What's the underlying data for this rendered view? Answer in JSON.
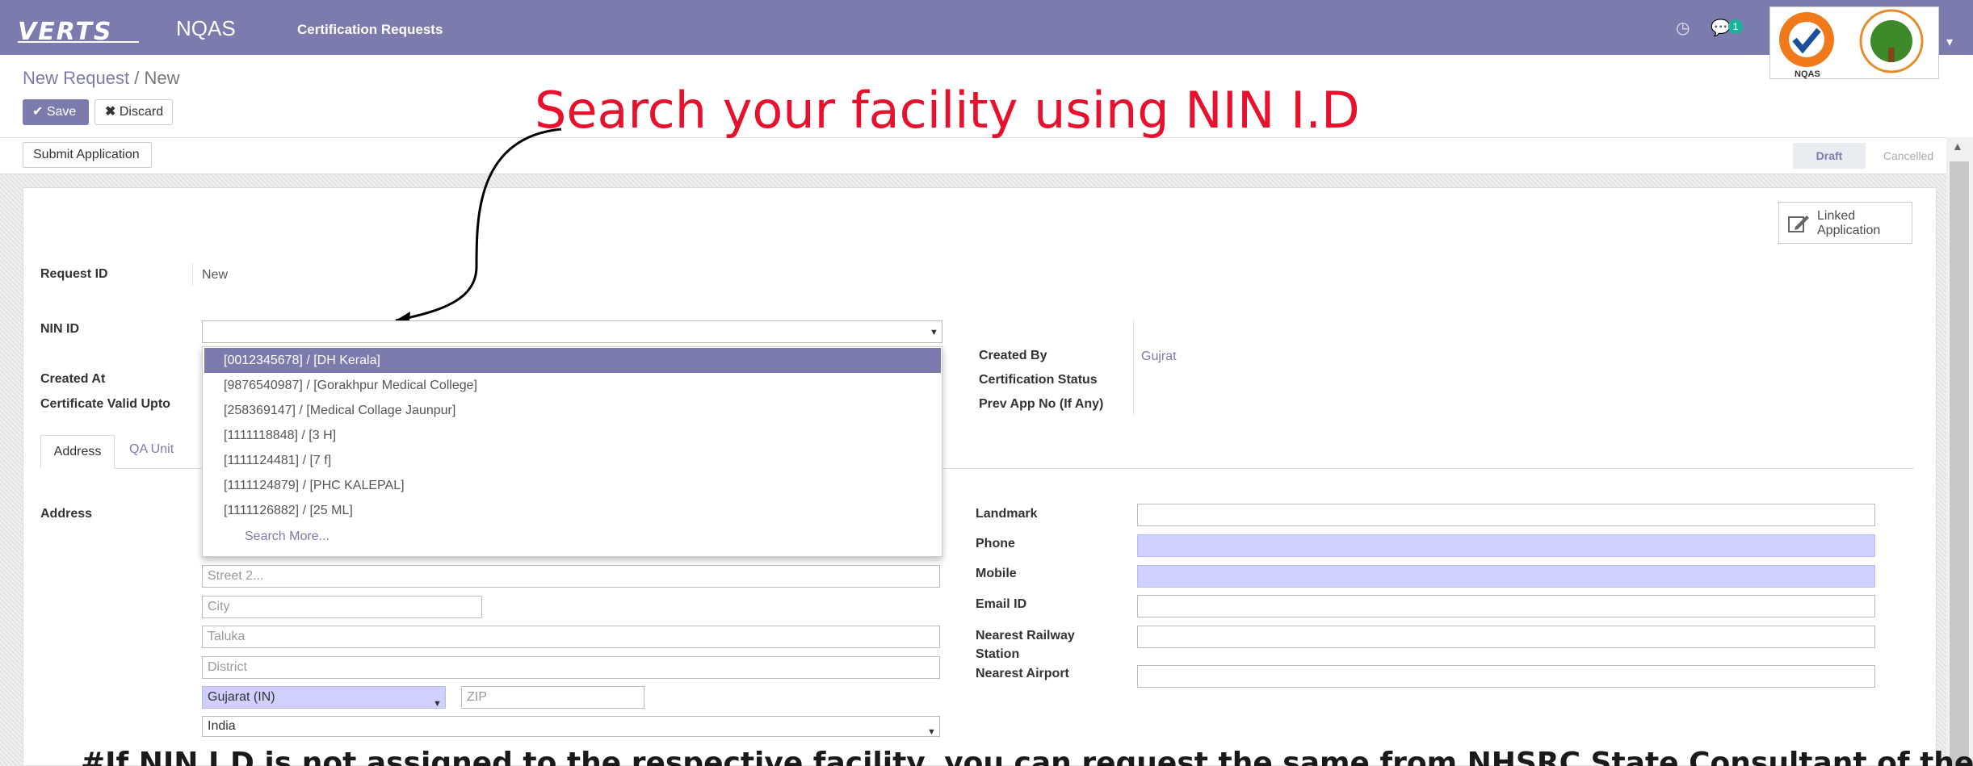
{
  "navbar": {
    "logo_text": "VERTS",
    "app_name": "NQAS",
    "menu_item": "Certification Requests",
    "messages_count": "1",
    "logo_badge": "NQAS"
  },
  "breadcrumb": {
    "parent": "New Request",
    "separator": "/",
    "current": "New"
  },
  "buttons": {
    "save": "Save",
    "discard": "Discard",
    "submit": "Submit Application"
  },
  "statusbar": {
    "stages": [
      "Draft",
      "Cancelled"
    ],
    "active": "Draft"
  },
  "annotation": {
    "title": "Search your facility using NIN I.D",
    "footer": "#If NIN I.D is not assigned to the respective facility, you can request the same from NHSRC State Consultant of the"
  },
  "smart_button": {
    "label": "Linked Application"
  },
  "form": {
    "request_id_label": "Request ID",
    "request_id_value": "New",
    "nin_id_label": "NIN ID",
    "nin_id_value": "",
    "created_at_label": "Created At",
    "valid_upto_label": "Certificate Valid Upto",
    "created_by_label": "Created By",
    "created_by_value": "Gujrat",
    "cert_status_label": "Certification Status",
    "prev_app_label": "Prev App No (If Any)"
  },
  "nin_dropdown": {
    "options": [
      "[0012345678] / [DH Kerala]",
      "[9876540987] / [Gorakhpur Medical College]",
      "[258369147] / [Medical Collage Jaunpur]",
      "[1111118848] / [3 H]",
      "[1111124481] / [7 f]",
      "[1111124879] / [PHC KALEPAL]",
      "[1111126882] / [25 ML]"
    ],
    "search_more": "Search More..."
  },
  "tabs": [
    "Address",
    "QA Unit"
  ],
  "address": {
    "label": "Address",
    "street2_placeholder": "Street 2...",
    "city_placeholder": "City",
    "taluka_placeholder": "Taluka",
    "district_placeholder": "District",
    "state_value": "Gujarat (IN)",
    "zip_placeholder": "ZIP",
    "country_value": "India"
  },
  "contact": {
    "landmark_label": "Landmark",
    "phone_label": "Phone",
    "mobile_label": "Mobile",
    "email_label": "Email ID",
    "railway_label": "Nearest Railway Station",
    "airport_label": "Nearest Airport"
  },
  "colors": {
    "brand": "#7c7bad",
    "annotation_red": "#e8112d",
    "required_field": "#cfd0ff",
    "badge": "#1bb29a"
  }
}
